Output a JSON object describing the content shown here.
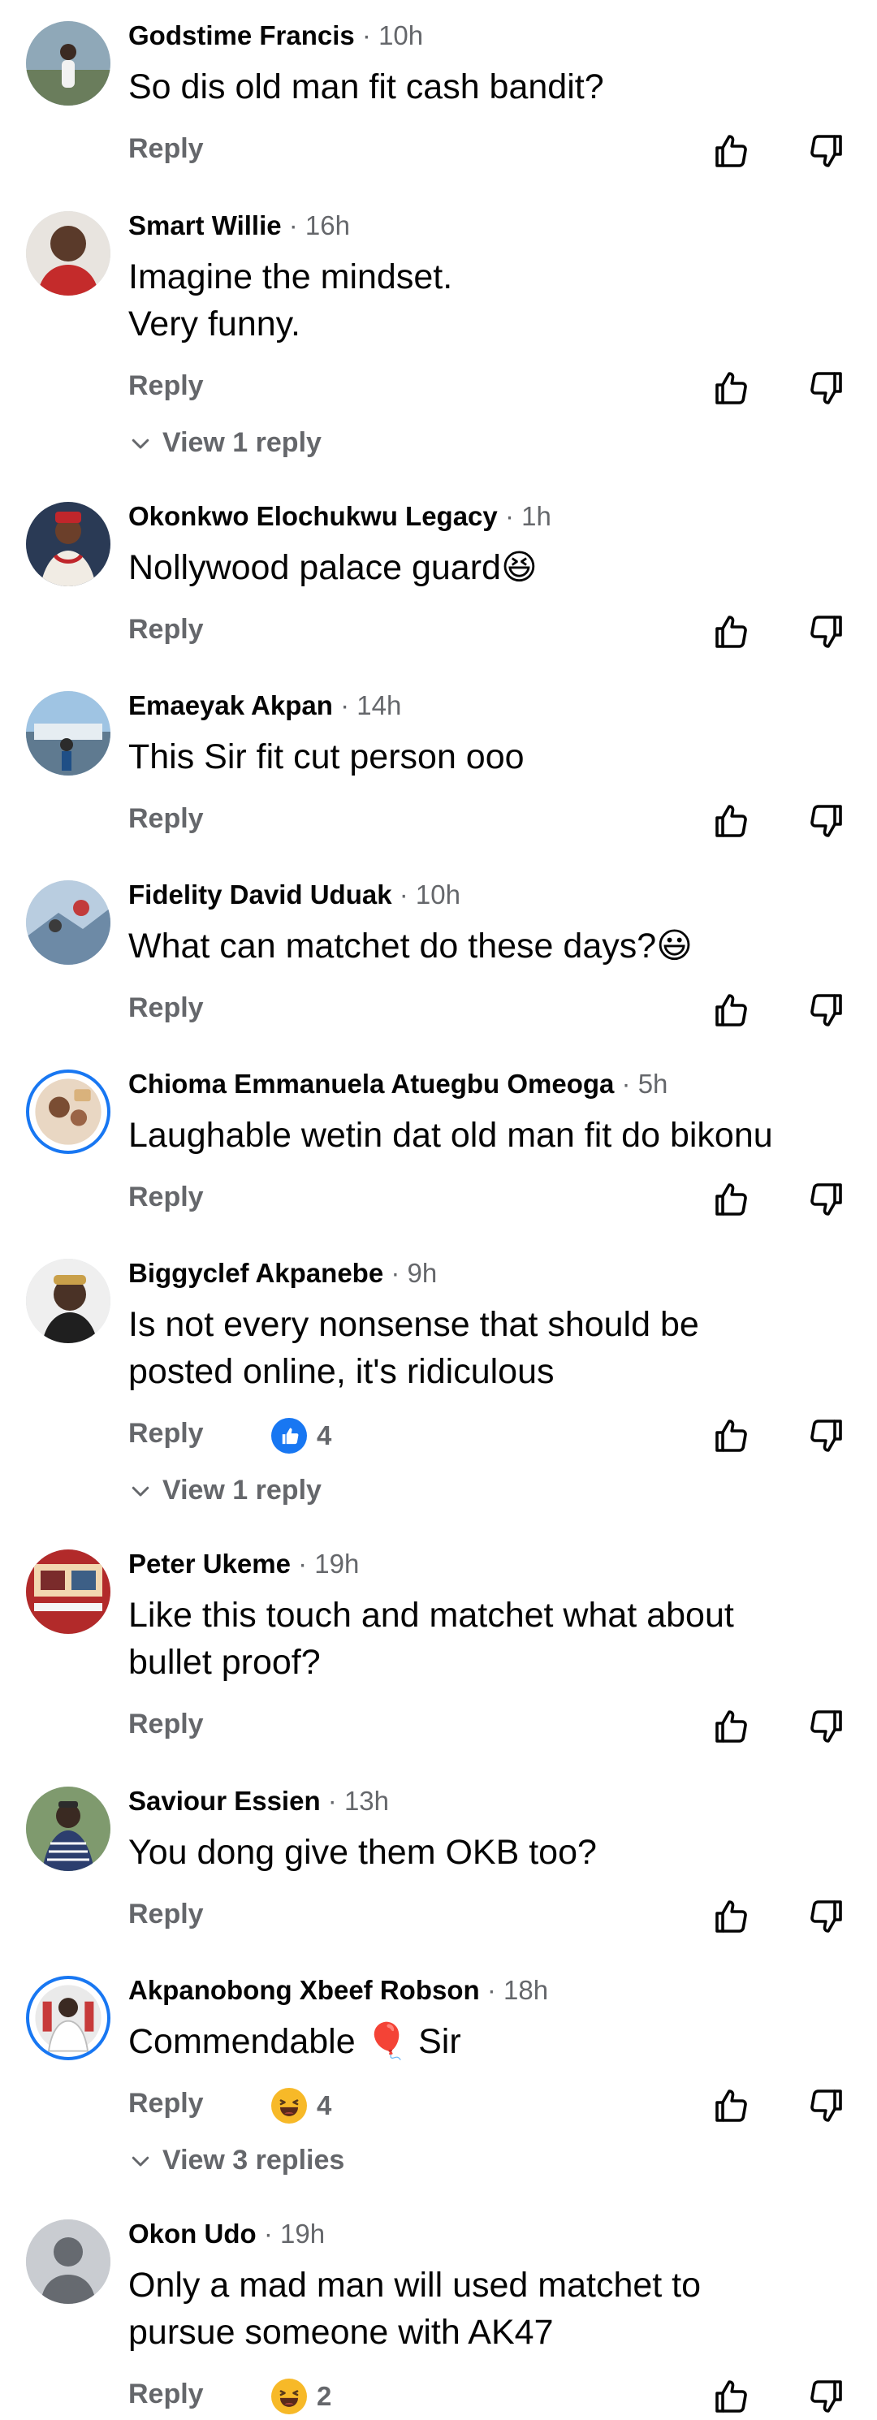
{
  "ui": {
    "reply_label": "Reply",
    "colors": {
      "text": "#050505",
      "meta": "#65676b",
      "like_blue": "#1877f2",
      "ring_blue": "#1877f2"
    }
  },
  "comments": [
    {
      "name": "Godstime Francis",
      "time": "· 10h",
      "lines": [
        "So dis old man fit cash bandit?"
      ],
      "avatar": "avatar-photo"
    },
    {
      "name": "Smart Willie",
      "time": "· 16h",
      "lines": [
        "Imagine the mindset.",
        "Very funny."
      ],
      "view_replies": "View 1 reply",
      "avatar": "avatar-photo"
    },
    {
      "name": "Okonkwo Elochukwu Legacy",
      "time": "· 1h",
      "lines": [
        "Nollywood palace guard😆"
      ],
      "avatar": "avatar-photo"
    },
    {
      "name": "Emaeyak Akpan",
      "time": "· 14h",
      "lines": [
        "This Sir fit cut person ooo"
      ],
      "avatar": "avatar-photo"
    },
    {
      "name": "Fidelity David Uduak",
      "time": "· 10h",
      "lines": [
        "What can matchet do these days?😃"
      ],
      "avatar": "avatar-photo"
    },
    {
      "name": "Chioma Emmanuela Atuegbu Omeoga",
      "time": "· 5h",
      "lines": [
        "Laughable wetin  dat old man fit do bikonu"
      ],
      "avatar": "avatar-photo-story-ring"
    },
    {
      "name": "Biggyclef Akpanebe",
      "time": "· 9h",
      "lines": [
        "Is not every nonsense that should be",
        "posted online, it's ridiculous"
      ],
      "reaction": {
        "icon": "like-reaction-icon",
        "count": "4"
      },
      "view_replies": "View 1 reply",
      "avatar": "avatar-photo"
    },
    {
      "name": "Peter Ukeme",
      "time": "· 19h",
      "lines": [
        "Like this touch and matchet what  about",
        "bullet proof?"
      ],
      "avatar": "avatar-photo"
    },
    {
      "name": "Saviour Essien",
      "time": "· 13h",
      "lines": [
        "You dong give them OKB too?"
      ],
      "avatar": "avatar-photo"
    },
    {
      "name": "Akpanobong Xbeef Robson",
      "time": "· 18h",
      "lines": [
        "Commendable 🎈 Sir"
      ],
      "reaction": {
        "icon": "haha-reaction-icon",
        "count": "4"
      },
      "view_replies": "View 3 replies",
      "avatar": "avatar-photo-story-ring"
    },
    {
      "name": "Okon Udo",
      "time": "· 19h",
      "lines": [
        "Only a mad man will used matchet to",
        "pursue someone with AK47"
      ],
      "reaction": {
        "icon": "haha-reaction-icon",
        "count": "2"
      },
      "avatar": "default-avatar-silhouette"
    }
  ]
}
